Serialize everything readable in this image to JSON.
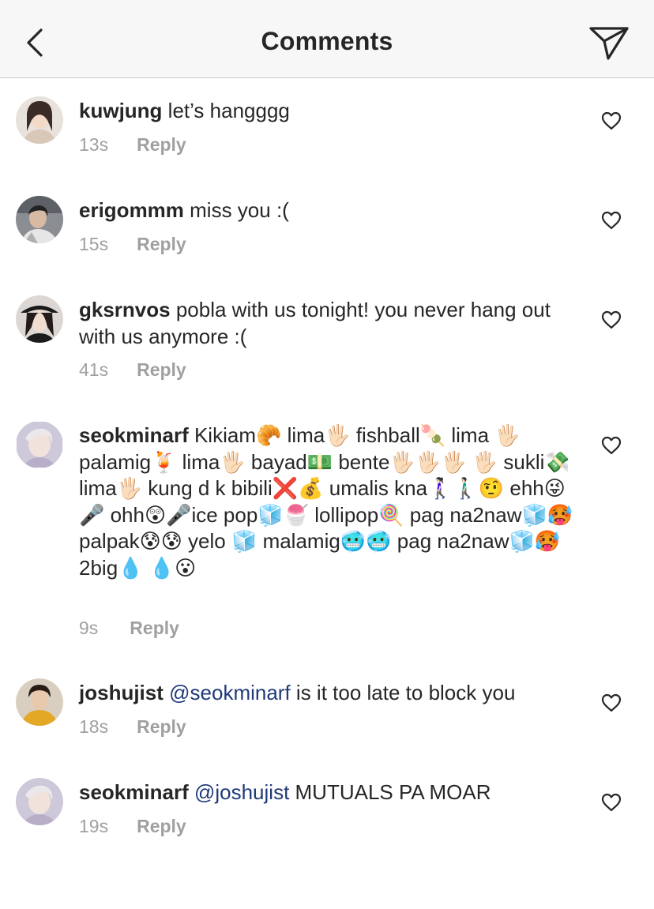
{
  "header": {
    "title": "Comments",
    "back_icon": "chevron-left-icon",
    "share_icon": "paper-plane-icon"
  },
  "comments": [
    {
      "username": "kuwjung",
      "text": " let’s hangggg",
      "time": "13s",
      "reply_label": "Reply"
    },
    {
      "username": "erigommm",
      "text": " miss you :(",
      "time": "15s",
      "reply_label": "Reply"
    },
    {
      "username": "gksrnvos",
      "text": " pobla with us tonight! you never hang out with us anymore :(",
      "time": "41s",
      "reply_label": "Reply"
    },
    {
      "username": "seokminarf",
      "text": " Kikiam🥐 lima🖐🏻 fishball🍡 lima 🖐🏻 palamig🍹 lima🖐🏻 bayad💵 bente🖐🏻🖐🏻🖐🏻 🖐🏻 sukli💸 lima🖐🏻 kung d k bibili❌💰 umalis kna🚶🏻‍♀️🚶🏻‍♂️🤨 ehh😜🎤 ohh😲🎤ice pop🧊🍧 lollipop🍭 pag na2naw🧊🥵 palpak😰😰 yelo 🧊 malamig🥶🥶 pag na2naw🧊🥵 2big💧 💧😮",
      "time": "9s",
      "reply_label": "Reply"
    },
    {
      "username": "joshujist",
      "mention": "@seokminarf",
      "text": " is it too late to block you",
      "time": "18s",
      "reply_label": "Reply"
    },
    {
      "username": "seokminarf",
      "mention": "@joshujist",
      "text": " MUTUALS PA MOAR",
      "time": "19s",
      "reply_label": "Reply"
    }
  ],
  "colors": {
    "mention": "#1f3a78",
    "meta": "#a0a0a0",
    "header_bg": "#f7f7f7"
  }
}
